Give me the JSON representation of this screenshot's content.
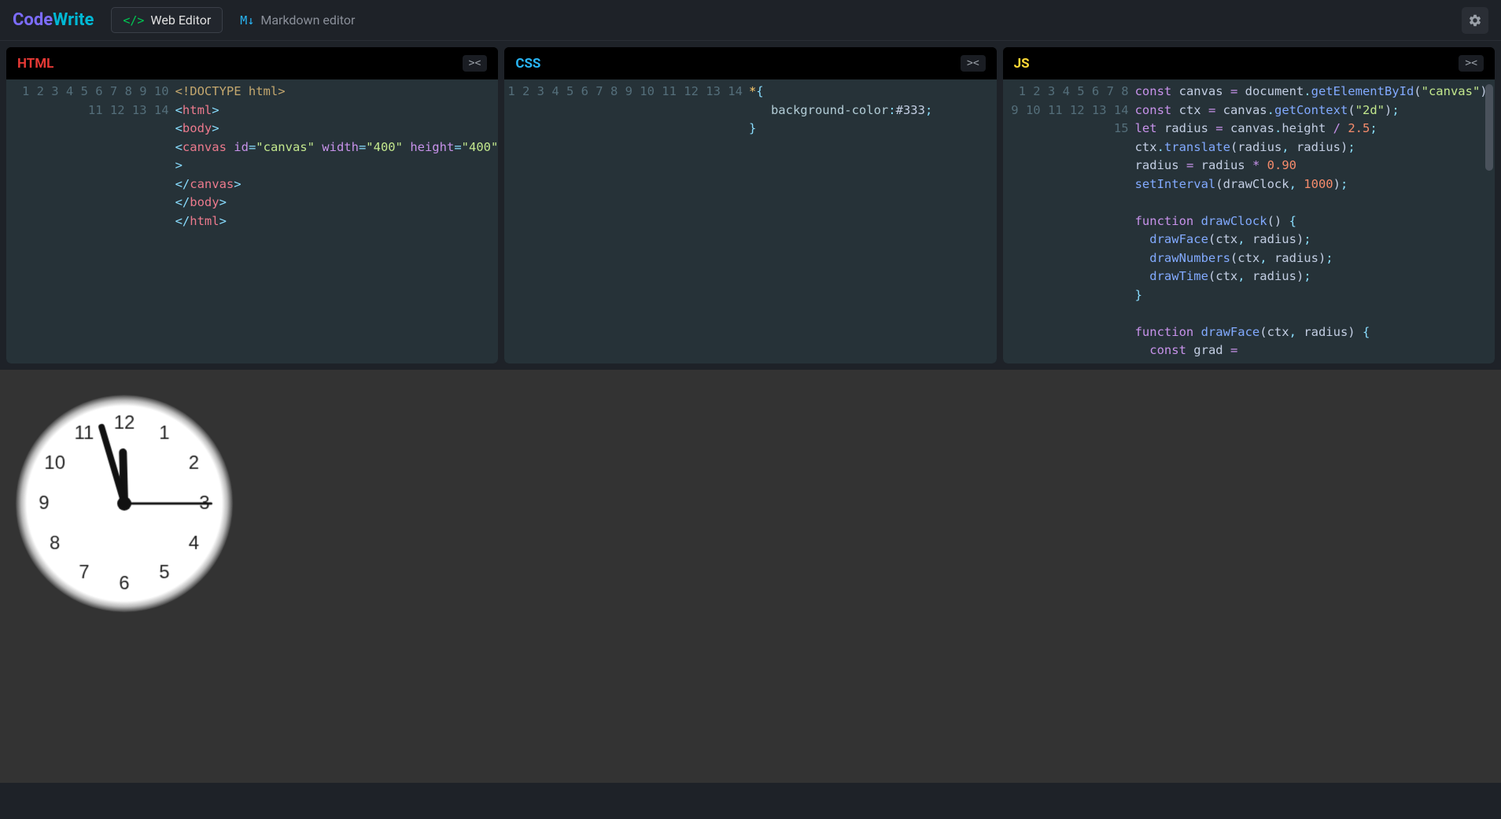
{
  "brand": {
    "part1": "Code",
    "part2": "Write"
  },
  "tabs": [
    {
      "icon": "</>",
      "label": "Web Editor",
      "active": true
    },
    {
      "icon": "M↓",
      "label": "Markdown editor",
      "active": false
    }
  ],
  "panels": {
    "html": {
      "title": "HTML",
      "collapse": "><",
      "lineCount": 14,
      "lines": [
        [
          {
            "c": "tok-doc",
            "t": "<!DOCTYPE html>"
          }
        ],
        [
          {
            "c": "tok-punct",
            "t": "<"
          },
          {
            "c": "tok-tag",
            "t": "html"
          },
          {
            "c": "tok-punct",
            "t": ">"
          }
        ],
        [
          {
            "c": "tok-punct",
            "t": "<"
          },
          {
            "c": "tok-tag",
            "t": "body"
          },
          {
            "c": "tok-punct",
            "t": ">"
          }
        ],
        [
          {
            "c": "tok-punct",
            "t": "<"
          },
          {
            "c": "tok-tag",
            "t": "canvas"
          },
          {
            "c": "",
            "t": " "
          },
          {
            "c": "tok-attr",
            "t": "id"
          },
          {
            "c": "tok-punct",
            "t": "="
          },
          {
            "c": "tok-str",
            "t": "\"canvas\""
          },
          {
            "c": "",
            "t": " "
          },
          {
            "c": "tok-attr",
            "t": "width"
          },
          {
            "c": "tok-punct",
            "t": "="
          },
          {
            "c": "tok-str",
            "t": "\"400\""
          },
          {
            "c": "",
            "t": " "
          },
          {
            "c": "tok-attr",
            "t": "height"
          },
          {
            "c": "tok-punct",
            "t": "="
          },
          {
            "c": "tok-str",
            "t": "\"400\""
          }
        ],
        [
          {
            "c": "tok-punct",
            "t": ">"
          }
        ],
        [
          {
            "c": "tok-punct",
            "t": "</"
          },
          {
            "c": "tok-tag",
            "t": "canvas"
          },
          {
            "c": "tok-punct",
            "t": ">"
          }
        ],
        [
          {
            "c": "tok-punct",
            "t": "</"
          },
          {
            "c": "tok-tag",
            "t": "body"
          },
          {
            "c": "tok-punct",
            "t": ">"
          }
        ],
        [
          {
            "c": "tok-punct",
            "t": "</"
          },
          {
            "c": "tok-tag",
            "t": "html"
          },
          {
            "c": "tok-punct",
            "t": ">"
          }
        ],
        [],
        [],
        [],
        [],
        [],
        []
      ]
    },
    "css": {
      "title": "CSS",
      "collapse": "><",
      "lineCount": 14,
      "lines": [
        [
          {
            "c": "tok-sel",
            "t": "*"
          },
          {
            "c": "tok-punct",
            "t": "{"
          }
        ],
        [
          {
            "c": "",
            "t": "   "
          },
          {
            "c": "tok-prop",
            "t": "background-color"
          },
          {
            "c": "tok-punct",
            "t": ":"
          },
          {
            "c": "tok-var",
            "t": "#333"
          },
          {
            "c": "tok-punct",
            "t": ";"
          }
        ],
        [
          {
            "c": "tok-punct",
            "t": "}"
          }
        ],
        [],
        [],
        [],
        [],
        [],
        [],
        [],
        [],
        [],
        [],
        []
      ]
    },
    "js": {
      "title": "JS",
      "collapse": "><",
      "lineCount": 15,
      "scrollbar": true,
      "lines": [
        [
          {
            "c": "tok-kw",
            "t": "const"
          },
          {
            "c": "",
            "t": " "
          },
          {
            "c": "tok-var",
            "t": "canvas"
          },
          {
            "c": "",
            "t": " "
          },
          {
            "c": "tok-eq",
            "t": "="
          },
          {
            "c": "",
            "t": " "
          },
          {
            "c": "tok-var",
            "t": "document"
          },
          {
            "c": "tok-punct",
            "t": "."
          },
          {
            "c": "tok-fn",
            "t": "getElementById"
          },
          {
            "c": "tok-paren",
            "t": "("
          },
          {
            "c": "tok-str",
            "t": "\"canvas\""
          },
          {
            "c": "tok-paren",
            "t": ")"
          },
          {
            "c": "tok-punct",
            "t": ";"
          }
        ],
        [
          {
            "c": "tok-kw",
            "t": "const"
          },
          {
            "c": "",
            "t": " "
          },
          {
            "c": "tok-var",
            "t": "ctx"
          },
          {
            "c": "",
            "t": " "
          },
          {
            "c": "tok-eq",
            "t": "="
          },
          {
            "c": "",
            "t": " "
          },
          {
            "c": "tok-var",
            "t": "canvas"
          },
          {
            "c": "tok-punct",
            "t": "."
          },
          {
            "c": "tok-fn",
            "t": "getContext"
          },
          {
            "c": "tok-paren",
            "t": "("
          },
          {
            "c": "tok-str",
            "t": "\"2d\""
          },
          {
            "c": "tok-paren",
            "t": ")"
          },
          {
            "c": "tok-punct",
            "t": ";"
          }
        ],
        [
          {
            "c": "tok-kw",
            "t": "let"
          },
          {
            "c": "",
            "t": " "
          },
          {
            "c": "tok-var",
            "t": "radius"
          },
          {
            "c": "",
            "t": " "
          },
          {
            "c": "tok-eq",
            "t": "="
          },
          {
            "c": "",
            "t": " "
          },
          {
            "c": "tok-var",
            "t": "canvas"
          },
          {
            "c": "tok-punct",
            "t": "."
          },
          {
            "c": "tok-var",
            "t": "height"
          },
          {
            "c": "",
            "t": " "
          },
          {
            "c": "tok-eq",
            "t": "/"
          },
          {
            "c": "",
            "t": " "
          },
          {
            "c": "tok-num",
            "t": "2.5"
          },
          {
            "c": "tok-punct",
            "t": ";"
          }
        ],
        [
          {
            "c": "tok-var",
            "t": "ctx"
          },
          {
            "c": "tok-punct",
            "t": "."
          },
          {
            "c": "tok-fn",
            "t": "translate"
          },
          {
            "c": "tok-paren",
            "t": "("
          },
          {
            "c": "tok-var",
            "t": "radius"
          },
          {
            "c": "tok-punct",
            "t": ","
          },
          {
            "c": "",
            "t": " "
          },
          {
            "c": "tok-var",
            "t": "radius"
          },
          {
            "c": "tok-paren",
            "t": ")"
          },
          {
            "c": "tok-punct",
            "t": ";"
          }
        ],
        [
          {
            "c": "tok-var",
            "t": "radius"
          },
          {
            "c": "",
            "t": " "
          },
          {
            "c": "tok-eq",
            "t": "="
          },
          {
            "c": "",
            "t": " "
          },
          {
            "c": "tok-var",
            "t": "radius"
          },
          {
            "c": "",
            "t": " "
          },
          {
            "c": "tok-eq",
            "t": "*"
          },
          {
            "c": "",
            "t": " "
          },
          {
            "c": "tok-num",
            "t": "0.90"
          }
        ],
        [
          {
            "c": "tok-fn",
            "t": "setInterval"
          },
          {
            "c": "tok-paren",
            "t": "("
          },
          {
            "c": "tok-var",
            "t": "drawClock"
          },
          {
            "c": "tok-punct",
            "t": ","
          },
          {
            "c": "",
            "t": " "
          },
          {
            "c": "tok-num",
            "t": "1000"
          },
          {
            "c": "tok-paren",
            "t": ")"
          },
          {
            "c": "tok-punct",
            "t": ";"
          }
        ],
        [],
        [
          {
            "c": "tok-kw",
            "t": "function"
          },
          {
            "c": "",
            "t": " "
          },
          {
            "c": "tok-fn",
            "t": "drawClock"
          },
          {
            "c": "tok-paren",
            "t": "()"
          },
          {
            "c": "",
            "t": " "
          },
          {
            "c": "tok-punct",
            "t": "{"
          }
        ],
        [
          {
            "c": "",
            "t": "  "
          },
          {
            "c": "tok-fn",
            "t": "drawFace"
          },
          {
            "c": "tok-paren",
            "t": "("
          },
          {
            "c": "tok-var",
            "t": "ctx"
          },
          {
            "c": "tok-punct",
            "t": ","
          },
          {
            "c": "",
            "t": " "
          },
          {
            "c": "tok-var",
            "t": "radius"
          },
          {
            "c": "tok-paren",
            "t": ")"
          },
          {
            "c": "tok-punct",
            "t": ";"
          }
        ],
        [
          {
            "c": "",
            "t": "  "
          },
          {
            "c": "tok-fn",
            "t": "drawNumbers"
          },
          {
            "c": "tok-paren",
            "t": "("
          },
          {
            "c": "tok-var",
            "t": "ctx"
          },
          {
            "c": "tok-punct",
            "t": ","
          },
          {
            "c": "",
            "t": " "
          },
          {
            "c": "tok-var",
            "t": "radius"
          },
          {
            "c": "tok-paren",
            "t": ")"
          },
          {
            "c": "tok-punct",
            "t": ";"
          }
        ],
        [
          {
            "c": "",
            "t": "  "
          },
          {
            "c": "tok-fn",
            "t": "drawTime"
          },
          {
            "c": "tok-paren",
            "t": "("
          },
          {
            "c": "tok-var",
            "t": "ctx"
          },
          {
            "c": "tok-punct",
            "t": ","
          },
          {
            "c": "",
            "t": " "
          },
          {
            "c": "tok-var",
            "t": "radius"
          },
          {
            "c": "tok-paren",
            "t": ")"
          },
          {
            "c": "tok-punct",
            "t": ";"
          }
        ],
        [
          {
            "c": "tok-punct",
            "t": "}"
          }
        ],
        [],
        [
          {
            "c": "tok-kw",
            "t": "function"
          },
          {
            "c": "",
            "t": " "
          },
          {
            "c": "tok-fn",
            "t": "drawFace"
          },
          {
            "c": "tok-paren",
            "t": "("
          },
          {
            "c": "tok-var",
            "t": "ctx"
          },
          {
            "c": "tok-punct",
            "t": ","
          },
          {
            "c": "",
            "t": " "
          },
          {
            "c": "tok-var",
            "t": "radius"
          },
          {
            "c": "tok-paren",
            "t": ")"
          },
          {
            "c": "",
            "t": " "
          },
          {
            "c": "tok-punct",
            "t": "{"
          }
        ],
        [
          {
            "c": "",
            "t": "  "
          },
          {
            "c": "tok-kw",
            "t": "const"
          },
          {
            "c": "",
            "t": " "
          },
          {
            "c": "tok-var",
            "t": "grad"
          },
          {
            "c": "",
            "t": " "
          },
          {
            "c": "tok-eq",
            "t": "="
          }
        ]
      ]
    }
  },
  "clock": {
    "hour": 11,
    "minute": 57,
    "second": 15
  }
}
